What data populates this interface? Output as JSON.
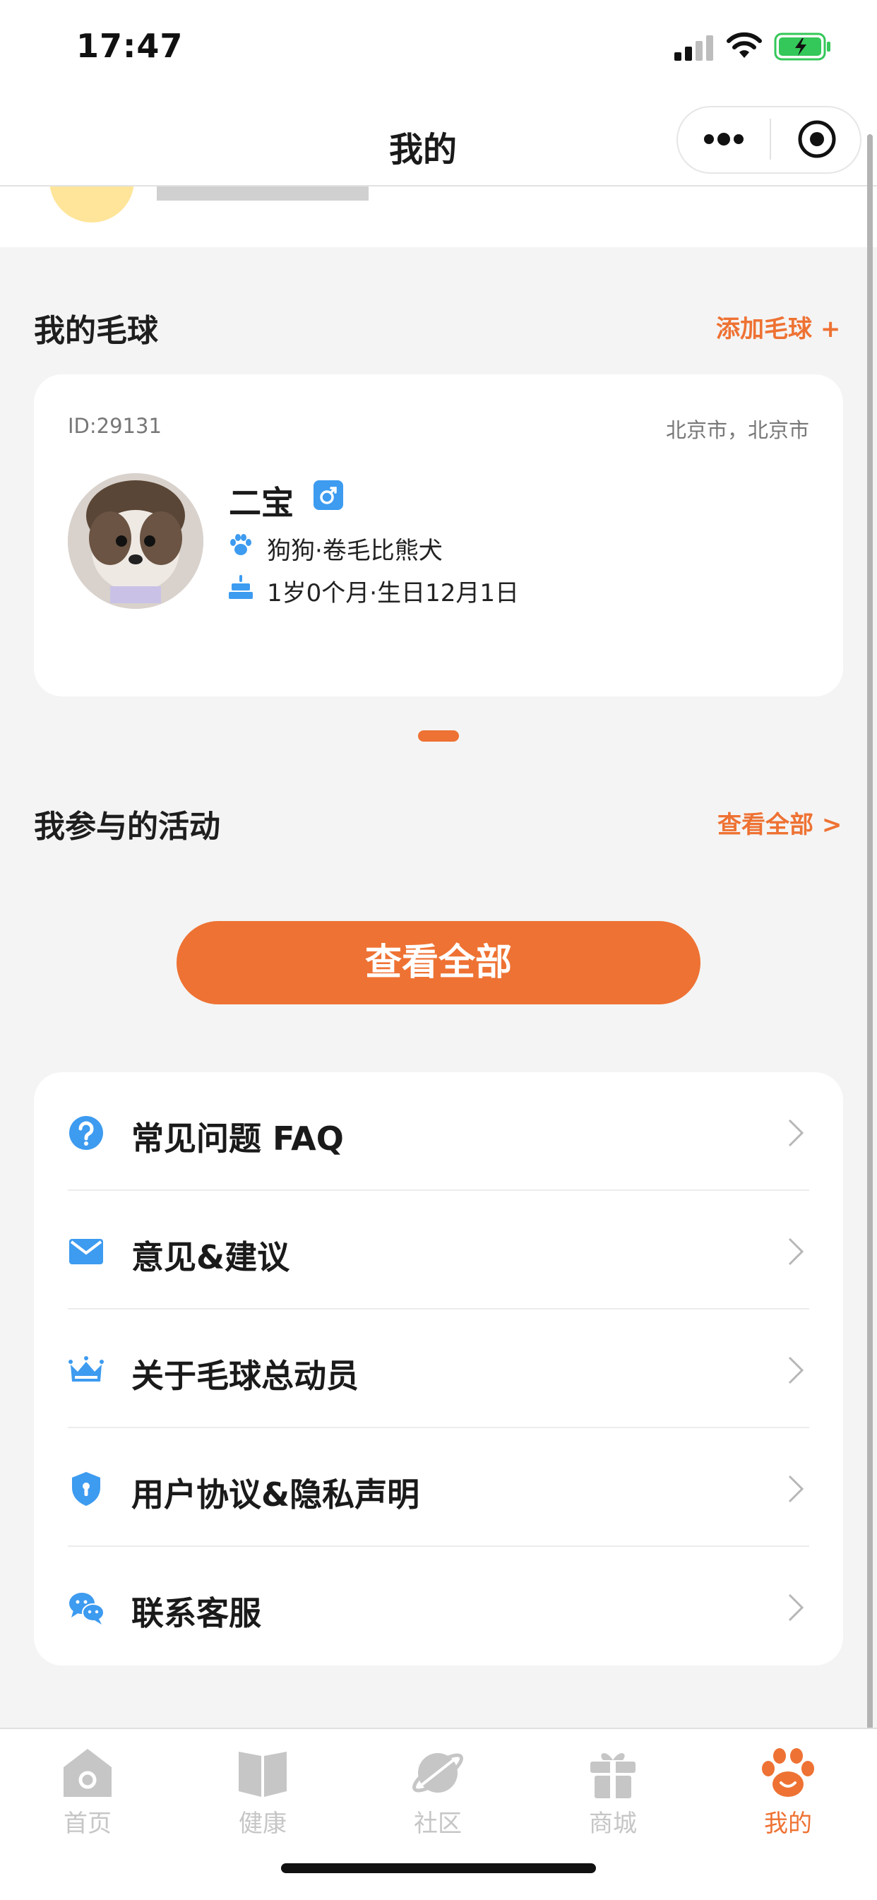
{
  "status_bar": {
    "time": "17:47"
  },
  "header": {
    "title": "我的"
  },
  "my_pets": {
    "section_title": "我的毛球",
    "add_link": "添加毛球 +",
    "pet": {
      "id_text": "ID:29131",
      "city": "北京市，北京市",
      "name": "二宝",
      "breed": "狗狗·卷毛比熊犬",
      "age_birthday": "1岁0个月·生日12月1日"
    }
  },
  "activities": {
    "section_title": "我参与的活动",
    "view_all_link": "查看全部 >",
    "view_all_button": "查看全部"
  },
  "menu": {
    "items": [
      {
        "label": "常见问题 FAQ",
        "icon": "question-icon"
      },
      {
        "label": "意见&建议",
        "icon": "mail-icon"
      },
      {
        "label": "关于毛球总动员",
        "icon": "crown-icon"
      },
      {
        "label": "用户协议&隐私声明",
        "icon": "shield-icon"
      },
      {
        "label": "联系客服",
        "icon": "chat-icon"
      }
    ]
  },
  "tab_bar": {
    "tabs": [
      {
        "label": "首页",
        "icon": "home-icon"
      },
      {
        "label": "健康",
        "icon": "book-icon"
      },
      {
        "label": "社区",
        "icon": "planet-icon"
      },
      {
        "label": "商城",
        "icon": "gift-icon"
      },
      {
        "label": "我的",
        "icon": "paw-icon"
      }
    ],
    "active_index": 4
  },
  "colors": {
    "accent": "#ee7233",
    "icon_blue": "#3d9bf0",
    "background": "#f4f4f4",
    "tab_inactive": "#c6c6c6"
  }
}
